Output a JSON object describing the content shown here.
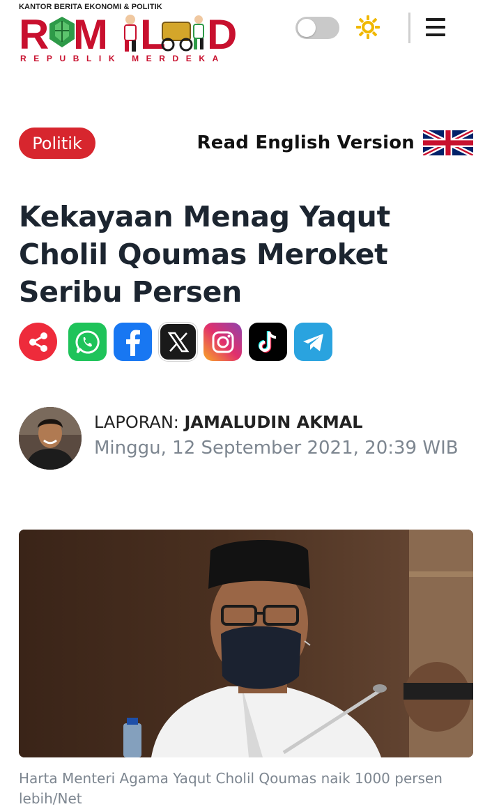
{
  "header": {
    "logo_tagline": "KANTOR BERITA EKONOMI & POLITIK",
    "logo_wordmark": "RMOL.ID",
    "logo_subtitle": "REPUBLIK MERDEKA",
    "brand_color": "#c8102e",
    "theme_toggle_icon": "toggle-off",
    "theme_icon": "sun-icon",
    "menu_icon": "hamburger-icon"
  },
  "article": {
    "category": "Politik",
    "category_color": "#d7262e",
    "read_english_label": "Read English Version",
    "flag_icon": "uk-flag-icon",
    "title": "Kekayaan Menag Yaqut Cholil Qoumas Meroket Seribu Persen",
    "share_buttons": [
      {
        "name": "share",
        "icon": "share-icon",
        "color": "#ee2b3b"
      },
      {
        "name": "whatsapp",
        "icon": "whatsapp-icon",
        "color": "#1fc35a"
      },
      {
        "name": "facebook",
        "icon": "facebook-icon",
        "color": "#1877f2"
      },
      {
        "name": "x",
        "icon": "x-icon",
        "color": "#1a1a1a"
      },
      {
        "name": "instagram",
        "icon": "instagram-icon",
        "color": "#d62976"
      },
      {
        "name": "tiktok",
        "icon": "tiktok-icon",
        "color": "#010101"
      },
      {
        "name": "telegram",
        "icon": "telegram-icon",
        "color": "#2aa3df"
      }
    ],
    "byline_prefix": "LAPORAN: ",
    "author": "JAMALUDIN AKMAL",
    "date": "Minggu, 12 September 2021, 20:39 WIB",
    "photo_caption": "Harta Menteri Agama Yaqut Cholil Qoumas naik 1000 persen lebih/Net"
  }
}
